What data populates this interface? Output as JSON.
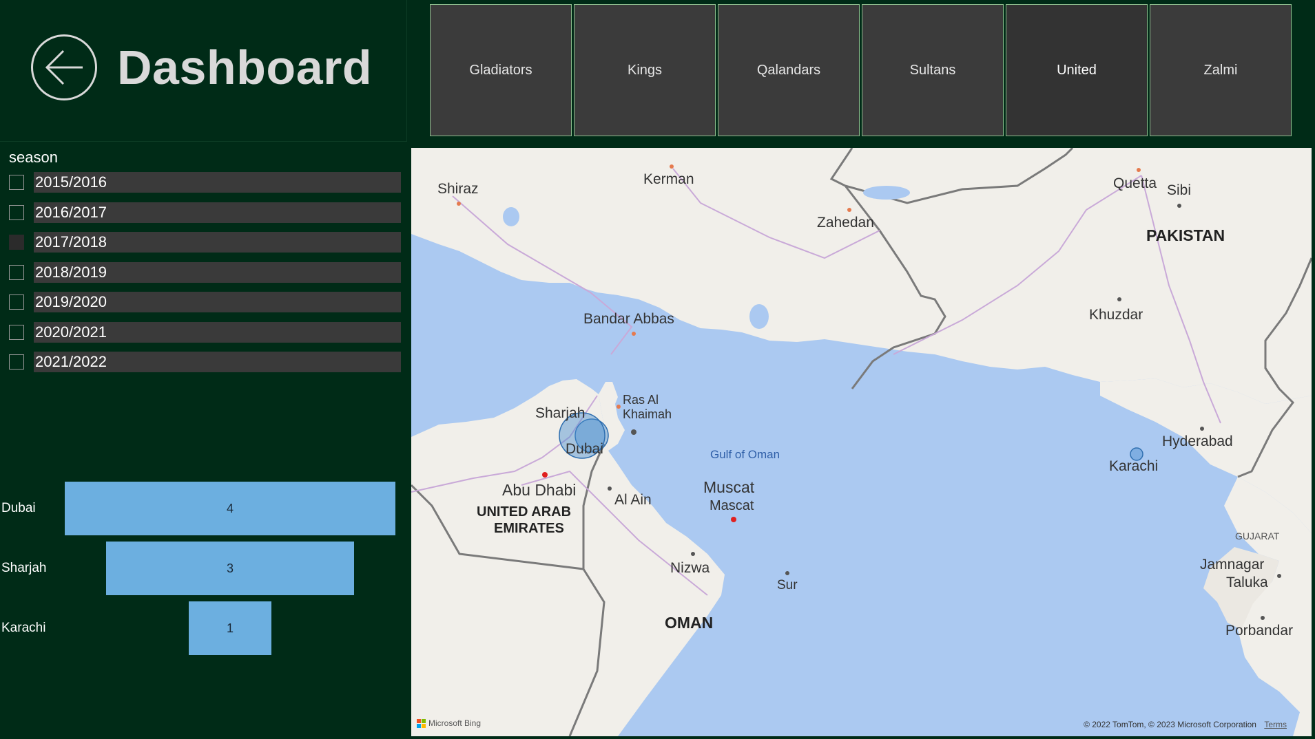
{
  "header": {
    "title": "Dashboard",
    "back_icon": "arrow-left-circle-icon"
  },
  "teams": [
    {
      "label": "Gladiators",
      "selected": false
    },
    {
      "label": "Kings",
      "selected": false
    },
    {
      "label": "Qalandars",
      "selected": false
    },
    {
      "label": "Sultans",
      "selected": false
    },
    {
      "label": "United",
      "selected": true
    },
    {
      "label": "Zalmi",
      "selected": false
    }
  ],
  "season_slicer": {
    "title": "season",
    "items": [
      {
        "label": "2015/2016",
        "checked": false
      },
      {
        "label": "2016/2017",
        "checked": false
      },
      {
        "label": "2017/2018",
        "checked": true
      },
      {
        "label": "2018/2019",
        "checked": false
      },
      {
        "label": "2019/2020",
        "checked": false
      },
      {
        "label": "2020/2021",
        "checked": false
      },
      {
        "label": "2021/2022",
        "checked": false
      }
    ]
  },
  "chart_data": {
    "type": "bar",
    "orientation": "horizontal-funnel",
    "categories": [
      "Dubai",
      "Sharjah",
      "Karachi"
    ],
    "values": [
      4,
      3,
      1
    ],
    "bar_color": "#6cafe0"
  },
  "map": {
    "labels": {
      "shiraz": "Shiraz",
      "kerman": "Kerman",
      "zahedan": "Zahedan",
      "quetta": "Quetta",
      "sibi": "Sibi",
      "pakistan": "PAKISTAN",
      "khuzdar": "Khuzdar",
      "bandar_abbas": "Bandar Abbas",
      "ras_al_khaimah_1": "Ras Al",
      "ras_al_khaimah_2": "Khaimah",
      "sharjah": "Sharjah",
      "dubai": "Dubai",
      "gulf_of_oman": "Gulf of Oman",
      "hyderabad": "Hyderabad",
      "karachi": "Karachi",
      "abu_dhabi": "Abu Dhabi",
      "uae_1": "UNITED ARAB",
      "uae_2": "EMIRATES",
      "al_ain": "Al Ain",
      "muscat": "Muscat",
      "mascat": "Mascat",
      "nizwa": "Nizwa",
      "sur": "Sur",
      "oman": "OMAN",
      "gujarat": "GUJARAT",
      "jamnagar_1": "Jamnagar",
      "jamnagar_2": "Taluka",
      "porbandar": "Porbandar"
    },
    "bing_logo": "Microsoft Bing",
    "copyright": "© 2022 TomTom, © 2023 Microsoft Corporation",
    "terms": "Terms",
    "land_color": "#f1efea",
    "sea_color": "#abc9f1",
    "bubble_color": "#4a8fd0"
  }
}
